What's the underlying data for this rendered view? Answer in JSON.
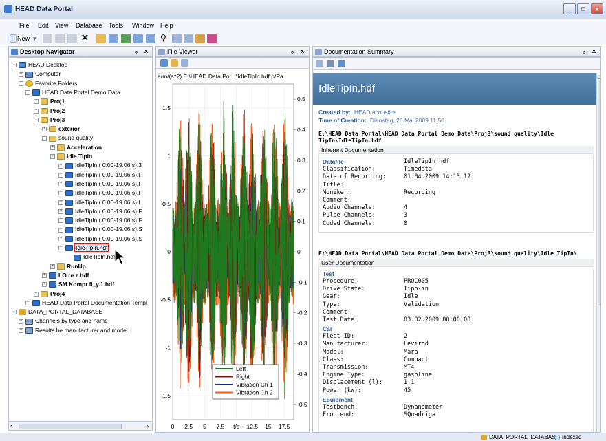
{
  "app": {
    "title": "HEAD Data Portal"
  },
  "window_buttons": {
    "minimize": "_",
    "restore": "□",
    "close": "x"
  },
  "menu": [
    "File",
    "Edit",
    "View",
    "Database",
    "Tools",
    "Window",
    "Help"
  ],
  "toolbar": {
    "new_label": "New"
  },
  "panes": {
    "navigator": {
      "title": "Desktop Navigator",
      "pin": "ᵩ",
      "close": "x"
    },
    "file_viewer": {
      "title": "File Viewer",
      "pin": "ᵩ",
      "close": "x"
    },
    "doc_summary": {
      "title": "Documentation Summary",
      "pin": "ᵩ",
      "close": "x"
    }
  },
  "tree": [
    {
      "label": "HEAD Desktop",
      "icon": "desktop",
      "exp": "-",
      "bold": false
    },
    {
      "label": "Computer",
      "icon": "computer",
      "exp": "+",
      "bold": false
    },
    {
      "label": "Favorite Folders",
      "icon": "star",
      "exp": "-",
      "bold": false
    },
    {
      "label": "HEAD Data Portal Demo Data",
      "icon": "hdf",
      "exp": "-",
      "bold": false
    },
    {
      "label": "Proj1",
      "icon": "folder",
      "exp": "+",
      "bold": true
    },
    {
      "label": "Proj2",
      "icon": "folder",
      "exp": "+",
      "bold": true
    },
    {
      "label": "Proj3",
      "icon": "folder",
      "exp": "-",
      "bold": true
    },
    {
      "label": "exterior",
      "icon": "folder",
      "exp": "+",
      "bold": true
    },
    {
      "label": "sound quality",
      "icon": "folder",
      "exp": "-",
      "bold": false
    },
    {
      "label": "Acceleration",
      "icon": "folder",
      "exp": "+",
      "bold": true
    },
    {
      "label": "Idle TipIn",
      "icon": "folder",
      "exp": "-",
      "bold": true
    },
    {
      "label": "IdleTipIn ( 0.00-19.06 s).3",
      "icon": "hdf",
      "exp": "+",
      "bold": false
    },
    {
      "label": "IdleTipIn ( 0.00-19.06 s).F",
      "icon": "hdf",
      "exp": "+",
      "bold": false
    },
    {
      "label": "IdleTipIn ( 0.00-19.06 s).F",
      "icon": "hdf",
      "exp": "+",
      "bold": false
    },
    {
      "label": "IdleTipIn ( 0.00-19.06 s).F",
      "icon": "hdf",
      "exp": "+",
      "bold": false
    },
    {
      "label": "IdleTipIn ( 0.00-19.06 s).L",
      "icon": "hdf",
      "exp": "+",
      "bold": false
    },
    {
      "label": "IdleTipIn ( 0.00-19.06 s).F",
      "icon": "hdf",
      "exp": "+",
      "bold": false
    },
    {
      "label": "IdleTipIn ( 0.00-19.06 s).F",
      "icon": "hdf",
      "exp": "+",
      "bold": false
    },
    {
      "label": "IdleTipIn ( 0.00-19.06 s).S",
      "icon": "hdf",
      "exp": "+",
      "bold": false
    },
    {
      "label": "IdleTipIn ( 0.00-19.06 s).S",
      "icon": "hdf",
      "exp": "+",
      "bold": false
    },
    {
      "label": "IdleTipIn.hdf",
      "icon": "hdf",
      "exp": "+",
      "bold": false,
      "selected": true
    },
    {
      "label": "IdleTipIn.hdf",
      "icon": "hdf",
      "exp": "",
      "bold": false
    },
    {
      "label": "RunUp",
      "icon": "folder",
      "exp": "+",
      "bold": true
    },
    {
      "label": "LO re z.hdf",
      "icon": "hdf",
      "exp": "+",
      "bold": true
    },
    {
      "label": "SM Kompr li_y.1.hdf",
      "icon": "hdf",
      "exp": "+",
      "bold": true
    },
    {
      "label": "Proj4",
      "icon": "folder",
      "exp": "+",
      "bold": true
    },
    {
      "label": "HEAD Data Portal Documentation Templ",
      "icon": "hdf",
      "exp": "+",
      "bold": false
    },
    {
      "label": "DATA_PORTAL_DATABASE",
      "icon": "db",
      "exp": "-",
      "bold": false
    },
    {
      "label": "Channels by type and name",
      "icon": "list",
      "exp": "+",
      "bold": false
    },
    {
      "label": "Results be manufacturer and model",
      "icon": "list",
      "exp": "+",
      "bold": false
    }
  ],
  "chart_data": {
    "type": "line",
    "title": "a/m/(s^2)  E:\\HEAD Data Por...\\IdleTipIn.hdf  p/Pa",
    "ylabel_left": "a/m/(s^2)",
    "ylabel_right": "p/Pa",
    "xlabel": "t/s",
    "xlim": [
      0,
      19
    ],
    "ylim_left": [
      -1.75,
      1.75
    ],
    "ylim_right": [
      -0.55,
      0.55
    ],
    "x_ticks": [
      "0",
      "2.5",
      "5",
      "7.5",
      "t/s",
      "12.5",
      "15",
      "17.5"
    ],
    "y_ticks_left": [
      "1.5",
      "1",
      "0.5",
      "0",
      "-0.5",
      "-1",
      "-1.5"
    ],
    "y_ticks_right": [
      "0.5",
      "0.4",
      "0.3",
      "0.2",
      "0.1",
      "0",
      "-0.1",
      "-0.2",
      "-0.3",
      "-0.4",
      "-0.5"
    ],
    "grid": true,
    "legend_position": "bottom-right",
    "series": [
      {
        "name": "Left",
        "color": "#1f7a1f",
        "axis": "right",
        "amplitude": 0.5
      },
      {
        "name": "Right",
        "color": "#8b1010",
        "axis": "right",
        "amplitude": 0.45
      },
      {
        "name": "Vibration Ch 1",
        "color": "#1a2a8c",
        "axis": "left",
        "amplitude": 1.1
      },
      {
        "name": "Vibration Ch 2",
        "color": "#ff5a14",
        "axis": "left",
        "amplitude": 1.6
      }
    ]
  },
  "doc": {
    "file_title": "IdleTipIn.hdf",
    "created_by_label": "Created by:",
    "created_by": "HEAD acoustics",
    "time_label": "Time of Creation:",
    "time": "Dienstag, 26.Mai 2009 11:50",
    "path1": "E:\\HEAD Data Portal\\HEAD Data Portal Demo Data\\Proj3\\sound quality\\Idle TipIn\\IdleTipIn.hdf",
    "inherent_header": "Inherent Documentation",
    "datafile_group": "Datafile",
    "inherent": [
      [
        "Datafile",
        "IdleTipIn.hdf"
      ],
      [
        "Classification:",
        "Timedata"
      ],
      [
        "Date of Recording:",
        "01.04.2009 14:13:12"
      ],
      [
        "Title:",
        ""
      ],
      [
        "Moniker:",
        "Recording"
      ],
      [
        "Comment:",
        ""
      ],
      [
        "Audio Channels:",
        "4"
      ],
      [
        "Pulse Channels:",
        "3"
      ],
      [
        "Coded Channels:",
        "0"
      ]
    ],
    "path2": "E:\\HEAD Data Portal\\HEAD Data Portal Demo Data\\Proj3\\sound quality\\Idle TipIn\\",
    "user_header": "User Documentation",
    "test_group": "Test",
    "test": [
      [
        "Procedure:",
        "PROC005"
      ],
      [
        "Drive State:",
        "Tipp-in"
      ],
      [
        "Gear:",
        "Idle"
      ],
      [
        "Type:",
        "Validation"
      ],
      [
        "Comment:",
        ""
      ],
      [
        "Test Date:",
        "03.02.2009 00:00:00"
      ]
    ],
    "car_group": "Car",
    "car": [
      [
        "Fleet ID:",
        "2"
      ],
      [
        "Manufacturer:",
        "Levirod"
      ],
      [
        "Model:",
        "Mara"
      ],
      [
        "Class:",
        "Compact"
      ],
      [
        "Transmission:",
        "MT4"
      ],
      [
        "Engine Type:",
        "gasoline"
      ],
      [
        "Displacement (l):",
        "1,1"
      ],
      [
        "Power (kW):",
        "45"
      ]
    ],
    "equipment_group": "Equipment",
    "equipment": [
      [
        "Testbench:",
        "Dynanometer"
      ],
      [
        "Frontend:",
        "SQuadriga"
      ]
    ]
  },
  "status": {
    "database": "DATA_PORTAL_DATABASE",
    "indexed": "Indexed"
  }
}
